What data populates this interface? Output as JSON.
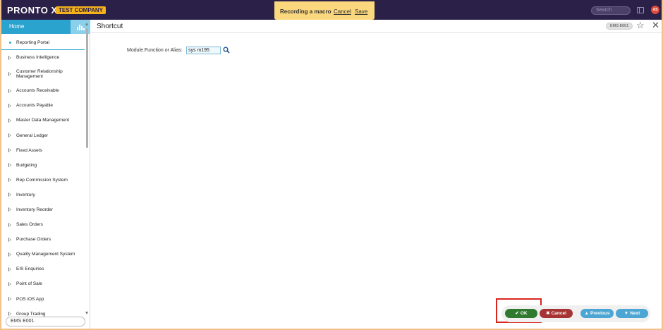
{
  "app": {
    "logo": "PRONTO Xi",
    "company": "TEST COMPANY"
  },
  "macro_banner": {
    "title": "Recording a macro",
    "cancel": "Cancel",
    "save": "Save"
  },
  "topbar": {
    "search_placeholder": "Search",
    "avatar_initials": "AS"
  },
  "sidebar": {
    "home_tab": "Home",
    "items": [
      {
        "label": "Reporting Portal",
        "active": true
      },
      {
        "label": "Business Intelligence"
      },
      {
        "label": "Customer Relationship Management"
      },
      {
        "label": "Accounts Receivable"
      },
      {
        "label": "Accounts Payable"
      },
      {
        "label": "Master Data Management"
      },
      {
        "label": "General Ledger"
      },
      {
        "label": "Fixed Assets"
      },
      {
        "label": "Budgeting"
      },
      {
        "label": "Rep Commission System"
      },
      {
        "label": "Inventory"
      },
      {
        "label": "Inventory Reorder"
      },
      {
        "label": "Sales Orders"
      },
      {
        "label": "Purchase Orders"
      },
      {
        "label": "Quality Management System"
      },
      {
        "label": "EIS Enquiries"
      },
      {
        "label": "Point of Sale"
      },
      {
        "label": "POS iOS App"
      },
      {
        "label": "Group Trading"
      }
    ],
    "bottom_field": "EMS E001"
  },
  "main": {
    "title": "Shortcut",
    "code_badge": "EMS E001",
    "field_label": "Module.Function or Alias:",
    "field_value": "sys m195"
  },
  "actions": {
    "ok": "OK",
    "cancel": "Cancel",
    "previous": "Previous",
    "next": "Next"
  },
  "colors": {
    "topbar": "#2a2048",
    "accent": "#2aa3cf",
    "ok": "#2f7a2e",
    "cancel": "#a73434",
    "nav": "#4ca6d4",
    "highlight": "#d8261f",
    "macro_banner": "#fbd77d"
  }
}
